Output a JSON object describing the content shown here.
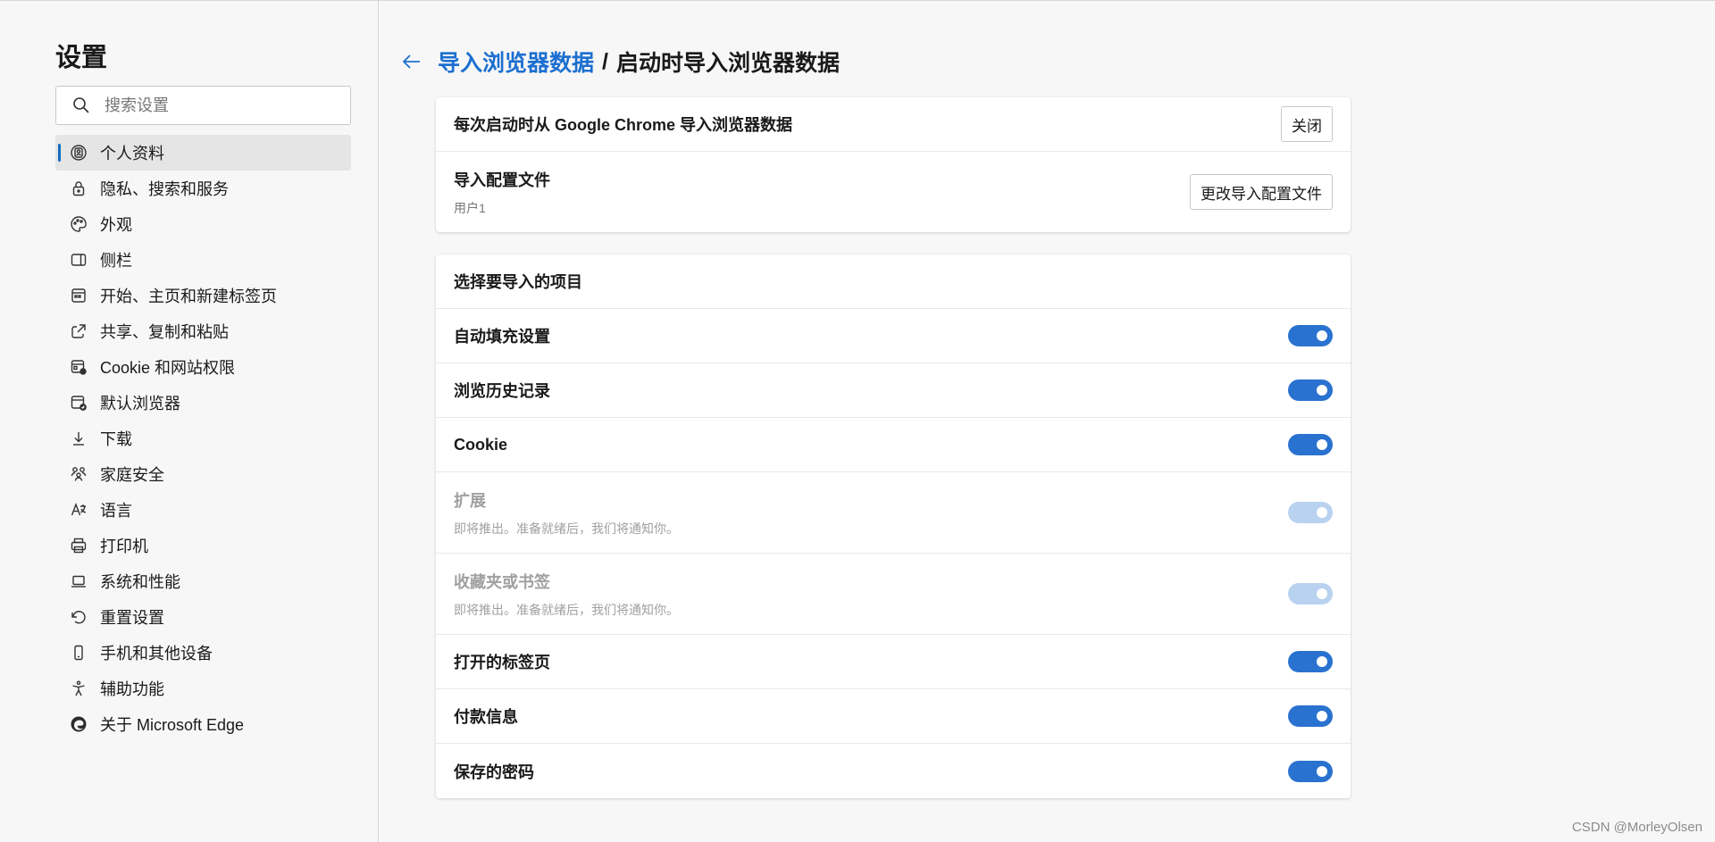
{
  "sidebar": {
    "title": "设置",
    "search_placeholder": "搜索设置",
    "items": [
      {
        "label": "个人资料",
        "icon": "profile-icon",
        "active": true
      },
      {
        "label": "隐私、搜索和服务",
        "icon": "lock-icon"
      },
      {
        "label": "外观",
        "icon": "palette-icon"
      },
      {
        "label": "侧栏",
        "icon": "sidebar-icon"
      },
      {
        "label": "开始、主页和新建标签页",
        "icon": "home-tabs-icon"
      },
      {
        "label": "共享、复制和粘贴",
        "icon": "share-icon"
      },
      {
        "label": "Cookie 和网站权限",
        "icon": "site-permissions-icon"
      },
      {
        "label": "默认浏览器",
        "icon": "default-browser-icon"
      },
      {
        "label": "下载",
        "icon": "download-icon"
      },
      {
        "label": "家庭安全",
        "icon": "family-icon"
      },
      {
        "label": "语言",
        "icon": "language-icon"
      },
      {
        "label": "打印机",
        "icon": "printer-icon"
      },
      {
        "label": "系统和性能",
        "icon": "laptop-icon"
      },
      {
        "label": "重置设置",
        "icon": "reset-icon"
      },
      {
        "label": "手机和其他设备",
        "icon": "phone-icon"
      },
      {
        "label": "辅助功能",
        "icon": "accessibility-icon"
      },
      {
        "label": "关于 Microsoft Edge",
        "icon": "edge-logo-icon"
      }
    ]
  },
  "breadcrumb": {
    "parent": "导入浏览器数据",
    "separator": "/",
    "current": "启动时导入浏览器数据"
  },
  "import_card": {
    "startup_label": "每次启动时从 Google Chrome 导入浏览器数据",
    "startup_button": "关闭",
    "profile_label": "导入配置文件",
    "profile_value": "用户1",
    "profile_button": "更改导入配置文件"
  },
  "items_card": {
    "header": "选择要导入的项目",
    "items": [
      {
        "label": "自动填充设置",
        "on": true,
        "disabled": false
      },
      {
        "label": "浏览历史记录",
        "on": true,
        "disabled": false
      },
      {
        "label": "Cookie",
        "on": true,
        "disabled": false
      },
      {
        "label": "扩展",
        "sub": "即将推出。准备就绪后，我们将通知你。",
        "on": true,
        "disabled": true
      },
      {
        "label": "收藏夹或书签",
        "sub": "即将推出。准备就绪后，我们将通知你。",
        "on": true,
        "disabled": true
      },
      {
        "label": "打开的标签页",
        "on": true,
        "disabled": false
      },
      {
        "label": "付款信息",
        "on": true,
        "disabled": false
      },
      {
        "label": "保存的密码",
        "on": true,
        "disabled": false
      }
    ]
  },
  "watermark": "CSDN @MorleyOlsen",
  "colors": {
    "accent": "#2a72d0",
    "link": "#1c6fd0",
    "toggle_disabled": "#b9d2f0"
  }
}
